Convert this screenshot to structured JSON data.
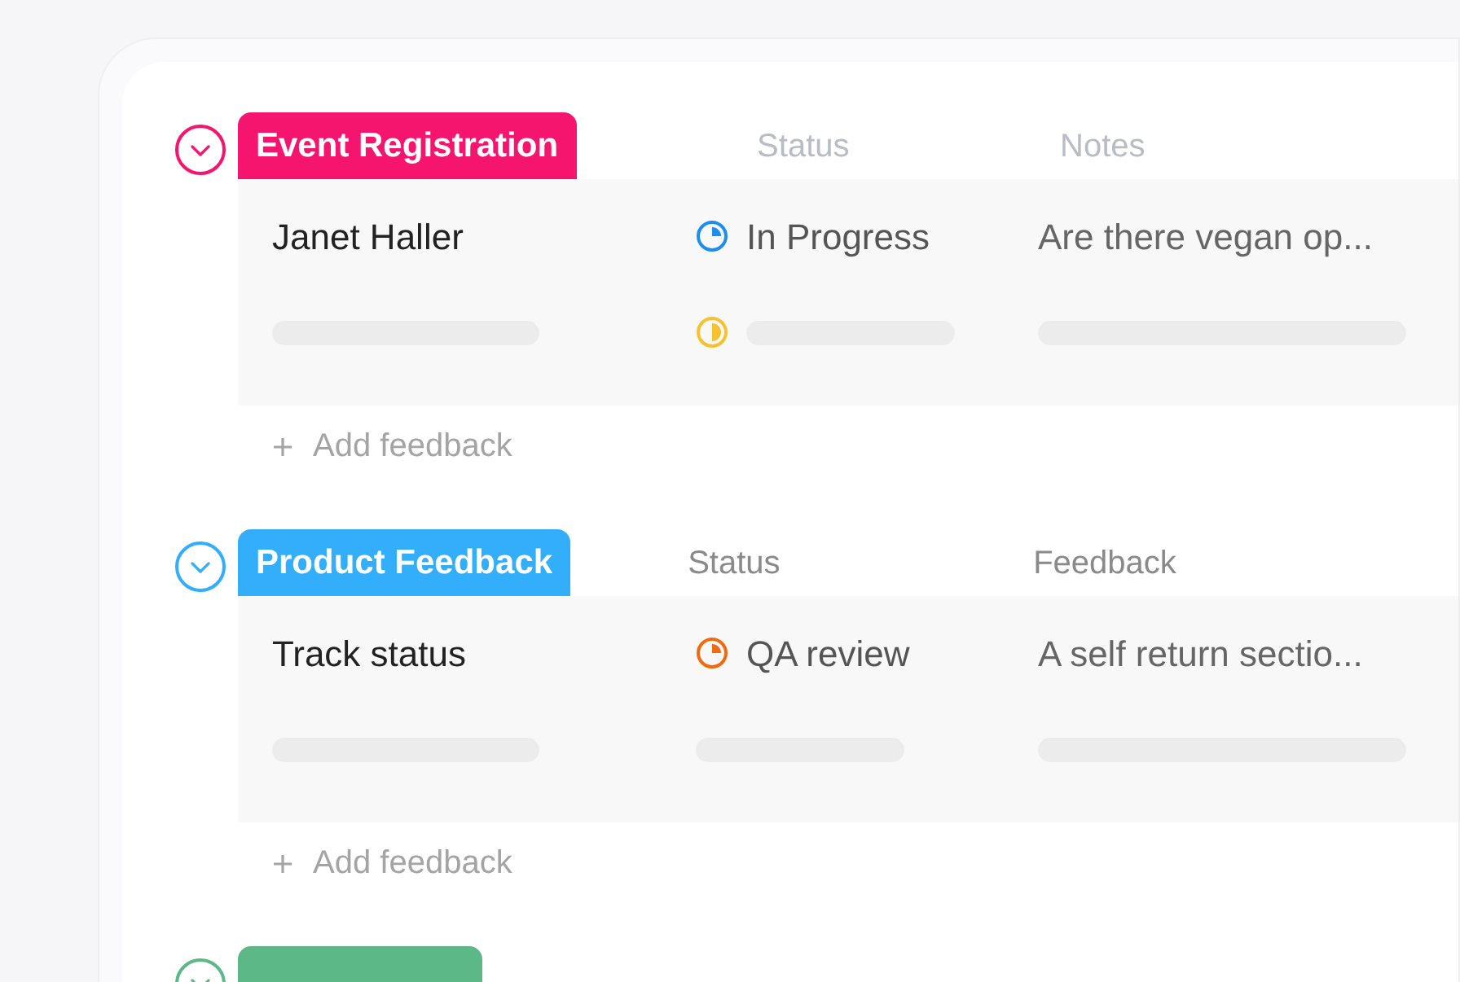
{
  "groups": [
    {
      "title": "Event Registration",
      "color": "#f5156f",
      "expanded": true,
      "columns": [
        "Status",
        "Notes"
      ],
      "columns_faded": true,
      "rows": [
        {
          "name": "Janet Haller",
          "status": "In Progress",
          "color": "#1d8df0",
          "note": "Are there vegan op..."
        }
      ],
      "placeholder_status": {
        "color": "#f8c12f"
      },
      "add_label": "Add feedback"
    },
    {
      "title": "Product Feedback",
      "color": "#33aefb",
      "expanded": true,
      "columns": [
        "Status",
        "Feedback"
      ],
      "columns_faded": false,
      "rows": [
        {
          "name": "Track status",
          "status": "QA review",
          "color": "#f06a10",
          "note": "A self return sectio..."
        }
      ],
      "add_label": "Add feedback"
    },
    {
      "color": "#5cb887",
      "expanded": true
    }
  ]
}
